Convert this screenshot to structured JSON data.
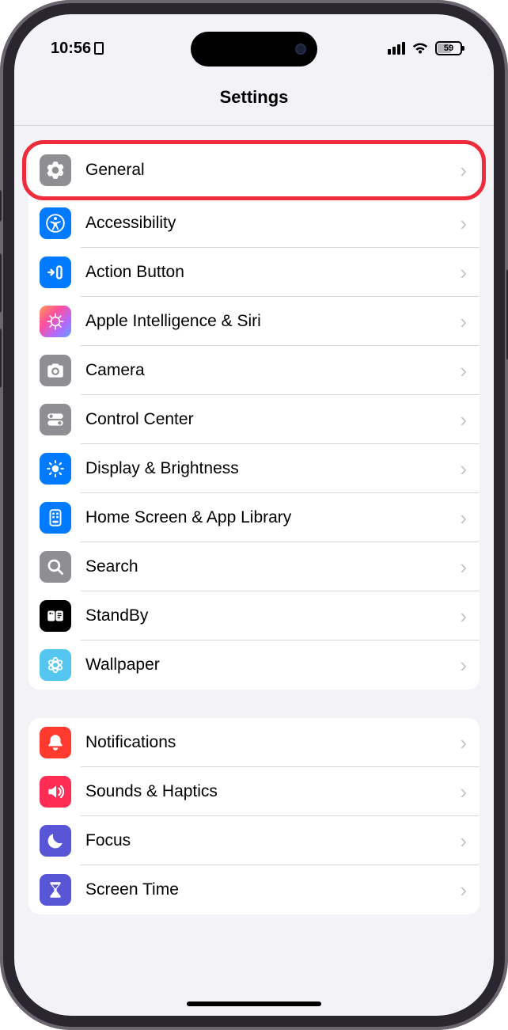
{
  "status": {
    "time": "10:56",
    "battery_pct": "59"
  },
  "header": {
    "title": "Settings"
  },
  "groups": [
    {
      "items": [
        {
          "label": "General",
          "icon": "gear-icon",
          "bg": "bg-gray",
          "highlighted": true
        },
        {
          "label": "Accessibility",
          "icon": "accessibility-icon",
          "bg": "bg-blue"
        },
        {
          "label": "Action Button",
          "icon": "action-button-icon",
          "bg": "bg-blue"
        },
        {
          "label": "Apple Intelligence & Siri",
          "icon": "apple-intelligence-icon",
          "bg": "bg-ai"
        },
        {
          "label": "Camera",
          "icon": "camera-icon",
          "bg": "bg-gray"
        },
        {
          "label": "Control Center",
          "icon": "control-center-icon",
          "bg": "bg-gray"
        },
        {
          "label": "Display & Brightness",
          "icon": "brightness-icon",
          "bg": "bg-blue"
        },
        {
          "label": "Home Screen & App Library",
          "icon": "home-screen-icon",
          "bg": "bg-blue"
        },
        {
          "label": "Search",
          "icon": "search-icon",
          "bg": "bg-gray"
        },
        {
          "label": "StandBy",
          "icon": "standby-icon",
          "bg": "bg-black"
        },
        {
          "label": "Wallpaper",
          "icon": "wallpaper-icon",
          "bg": "bg-cyan"
        }
      ]
    },
    {
      "items": [
        {
          "label": "Notifications",
          "icon": "bell-icon",
          "bg": "bg-red"
        },
        {
          "label": "Sounds & Haptics",
          "icon": "speaker-icon",
          "bg": "bg-pink"
        },
        {
          "label": "Focus",
          "icon": "moon-icon",
          "bg": "bg-indigo"
        },
        {
          "label": "Screen Time",
          "icon": "hourglass-icon",
          "bg": "bg-indigo"
        }
      ]
    }
  ]
}
